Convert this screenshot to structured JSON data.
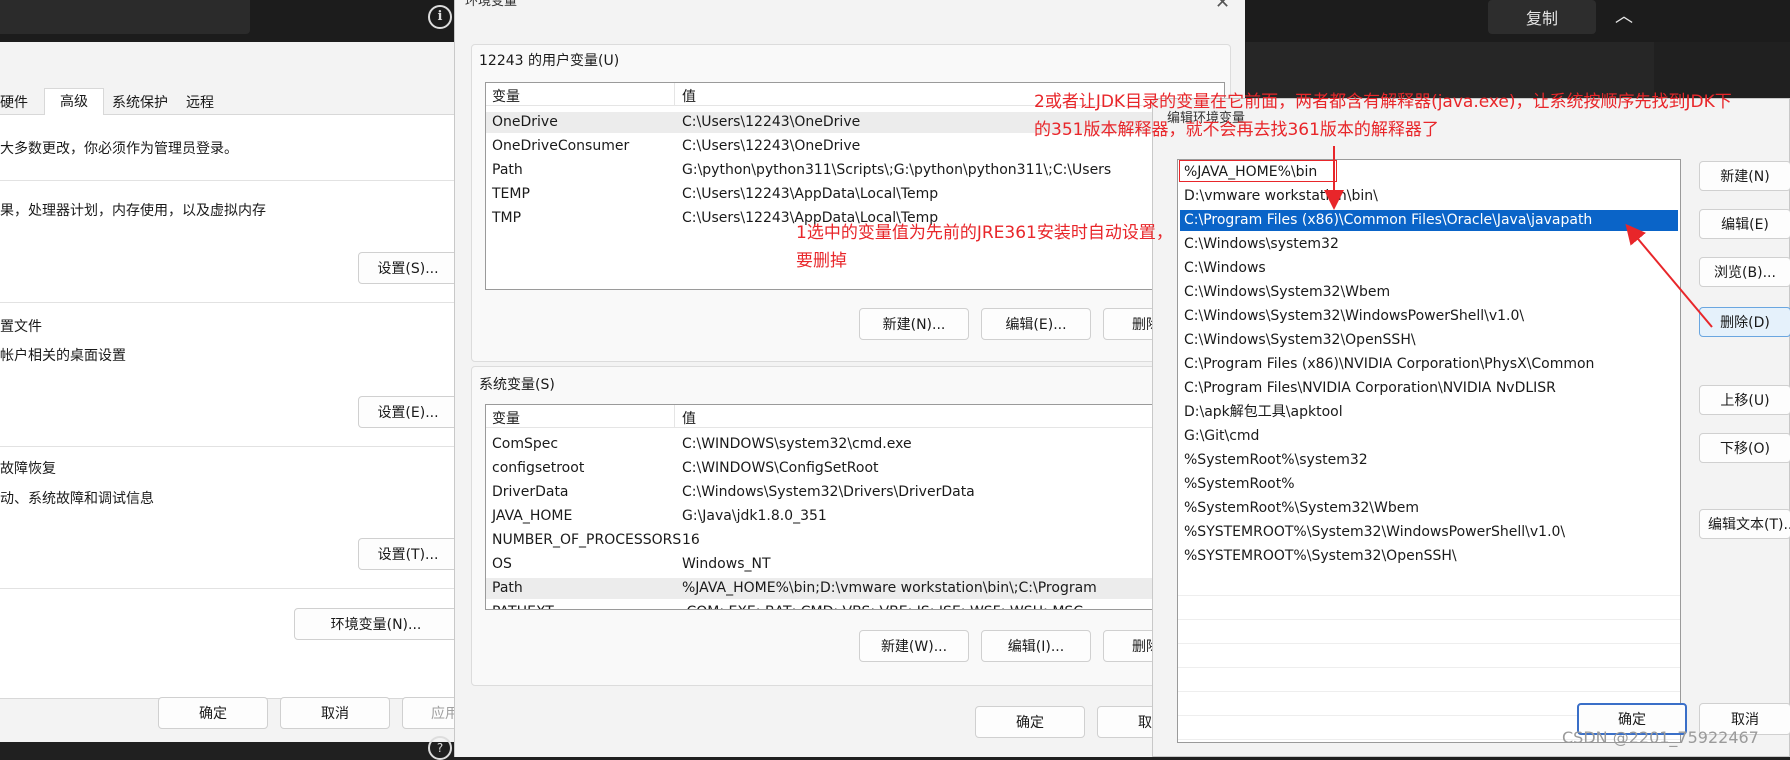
{
  "top_bar": {
    "copy_button": "复制"
  },
  "sysprops": {
    "tabs": [
      "硬件",
      "高级",
      "系统保护",
      "远程"
    ],
    "admin_note": "大多数更改，你必须作为管理员登录。",
    "perf_desc": "果，处理器计划，内存使用，以及虚拟内存",
    "settings_s": "设置(S)...",
    "profile_title": "置文件",
    "profile_desc": "帐户相关的桌面设置",
    "settings_e": "设置(E)...",
    "startup_title": "故障恢复",
    "startup_desc": "动、系统故障和调试信息",
    "settings_t": "设置(T)...",
    "env_button": "环境变量(N)...",
    "ok": "确定",
    "cancel": "取消",
    "apply": "应用"
  },
  "envvars": {
    "title": "环境变量",
    "user_group_label": "12243 的用户变量(U)",
    "col_var": "变量",
    "col_val": "值",
    "user_vars": [
      {
        "name": "OneDrive",
        "value": "C:\\Users\\12243\\OneDrive"
      },
      {
        "name": "OneDriveConsumer",
        "value": "C:\\Users\\12243\\OneDrive"
      },
      {
        "name": "Path",
        "value": "G:\\python\\python311\\Scripts\\;G:\\python\\python311\\;C:\\Users"
      },
      {
        "name": "TEMP",
        "value": "C:\\Users\\12243\\AppData\\Local\\Temp"
      },
      {
        "name": "TMP",
        "value": "C:\\Users\\12243\\AppData\\Local\\Temp"
      }
    ],
    "user_new": "新建(N)...",
    "user_edit": "编辑(E)...",
    "user_delete": "删除",
    "sys_group_label": "系统变量(S)",
    "sys_vars": [
      {
        "name": "ComSpec",
        "value": "C:\\WINDOWS\\system32\\cmd.exe"
      },
      {
        "name": "configsetroot",
        "value": "C:\\WINDOWS\\ConfigSetRoot"
      },
      {
        "name": "DriverData",
        "value": "C:\\Windows\\System32\\Drivers\\DriverData"
      },
      {
        "name": "JAVA_HOME",
        "value": "G:\\Java\\jdk1.8.0_351"
      },
      {
        "name": "NUMBER_OF_PROCESSORS",
        "value": "16"
      },
      {
        "name": "OS",
        "value": "Windows_NT"
      },
      {
        "name": "Path",
        "value": "%JAVA_HOME%\\bin;D:\\vmware workstation\\bin\\;C:\\Program"
      },
      {
        "name": "PATHEXT",
        "value": ".COM;.EXE;.BAT;.CMD;.VBS;.VBE;.JS;.JSE;.WSF;.WSH;.MSC"
      }
    ],
    "sys_new": "新建(W)...",
    "sys_edit": "编辑(I)...",
    "sys_delete": "删除",
    "ok": "确定",
    "cancel": "取消"
  },
  "edit_env": {
    "title": "编辑环境变量",
    "entries": [
      "%JAVA_HOME%\\bin",
      "D:\\vmware workstation\\bin\\",
      "C:\\Program Files (x86)\\Common Files\\Oracle\\Java\\javapath",
      "C:\\Windows\\system32",
      "C:\\Windows",
      "C:\\Windows\\System32\\Wbem",
      "C:\\Windows\\System32\\WindowsPowerShell\\v1.0\\",
      "C:\\Windows\\System32\\OpenSSH\\",
      "C:\\Program Files (x86)\\NVIDIA Corporation\\PhysX\\Common",
      "C:\\Program Files\\NVIDIA Corporation\\NVIDIA NvDLISR",
      "D:\\apk解包工具\\apktool",
      "G:\\Git\\cmd",
      "%SystemRoot%\\system32",
      "%SystemRoot%",
      "%SystemRoot%\\System32\\Wbem",
      "%SYSTEMROOT%\\System32\\WindowsPowerShell\\v1.0\\",
      "%SYSTEMROOT%\\System32\\OpenSSH\\"
    ],
    "btn_new": "新建(N)",
    "btn_edit": "编辑(E)",
    "btn_browse": "浏览(B)...",
    "btn_delete": "删除(D)",
    "btn_up": "上移(U)",
    "btn_down": "下移(O)",
    "btn_edit_text": "编辑文本(T)...",
    "ok": "确定",
    "cancel": "取消"
  },
  "annotations": {
    "note1": "1选中的变量值为先前的JRE361安装时自动设置，要删掉",
    "note2": "2或者让JDK目录的变量在它前面，两者都含有解释器(java.exe)，让系统按顺序先找到JDK下的351版本解释器，就不会再去找361版本的解释器了"
  },
  "watermark": "CSDN @2201_75922467",
  "colors": {
    "selection": "#0a64c8",
    "annotation_red": "#e8262a",
    "dark_bg": "#202020",
    "dialog_bg": "#f3f3f3"
  }
}
